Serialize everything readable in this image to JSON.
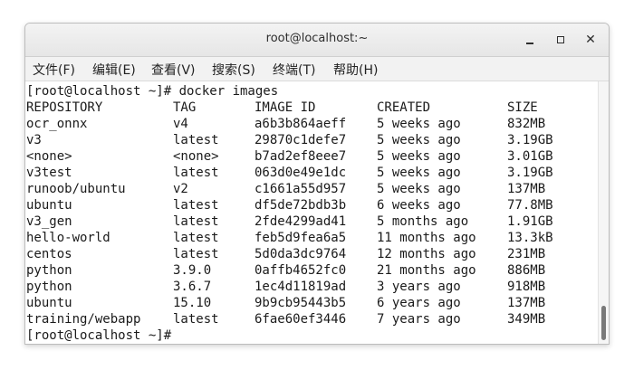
{
  "window": {
    "title": "root@localhost:~",
    "minimize_glyph": "",
    "close_glyph": "✕"
  },
  "menu": [
    {
      "label": "文件(F)"
    },
    {
      "label": "编辑(E)"
    },
    {
      "label": "查看(V)"
    },
    {
      "label": "搜索(S)"
    },
    {
      "label": "终端(T)"
    },
    {
      "label": "帮助(H)"
    }
  ],
  "terminal": {
    "command_line": "[root@localhost ~]# docker images",
    "prompt_line": "[root@localhost ~]#",
    "headers": [
      "REPOSITORY",
      "TAG",
      "IMAGE ID",
      "CREATED",
      "SIZE"
    ],
    "rows": [
      [
        "ocr_onnx",
        "v4",
        "a6b3b864aeff",
        "5 weeks ago",
        "832MB"
      ],
      [
        "v3",
        "latest",
        "29870c1defe7",
        "5 weeks ago",
        "3.19GB"
      ],
      [
        "<none>",
        "<none>",
        "b7ad2ef8eee7",
        "5 weeks ago",
        "3.01GB"
      ],
      [
        "v3test",
        "latest",
        "063d0e49e1dc",
        "5 weeks ago",
        "3.19GB"
      ],
      [
        "runoob/ubuntu",
        "v2",
        "c1661a55d957",
        "5 weeks ago",
        "137MB"
      ],
      [
        "ubuntu",
        "latest",
        "df5de72bdb3b",
        "6 weeks ago",
        "77.8MB"
      ],
      [
        "v3_gen",
        "latest",
        "2fde4299ad41",
        "5 months ago",
        "1.91GB"
      ],
      [
        "hello-world",
        "latest",
        "feb5d9fea6a5",
        "11 months ago",
        "13.3kB"
      ],
      [
        "centos",
        "latest",
        "5d0da3dc9764",
        "12 months ago",
        "231MB"
      ],
      [
        "python",
        "3.9.0",
        "0affb4652fc0",
        "21 months ago",
        "886MB"
      ],
      [
        "python",
        "3.6.7",
        "1ec4d11819ad",
        "3 years ago",
        "918MB"
      ],
      [
        "ubuntu",
        "15.10",
        "9b9cb95443b5",
        "6 years ago",
        "137MB"
      ],
      [
        "training/webapp",
        "latest",
        "6fae60ef3446",
        "7 years ago",
        "349MB"
      ]
    ]
  },
  "colors": {
    "titlebar": "#e9e9e9",
    "menubar": "#f2f2f2",
    "terminal_bg": "#ffffff",
    "text": "#1a1a1a"
  }
}
